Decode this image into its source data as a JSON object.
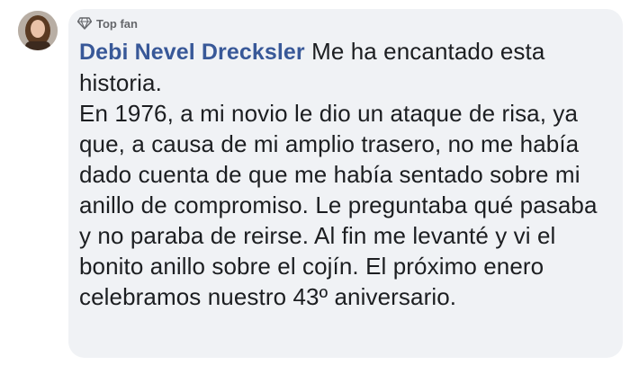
{
  "comment": {
    "badge": {
      "label": "Top fan",
      "icon": "diamond-icon"
    },
    "author": "Debi Nevel Drecksler",
    "text": " Me ha encantado esta historia.\nEn 1976, a mi novio le dio un ataque de risa, ya que, a causa de mi amplio trasero, no me había dado cuenta de que me había sentado sobre mi anillo de compromiso. Le preguntaba qué pasaba y no paraba de reirse. Al fin me levanté y vi el bonito anillo sobre el cojín. El próximo enero celebramos nuestro 43º aniversario."
  },
  "colors": {
    "author": "#385898",
    "bubble": "#f0f2f5",
    "text": "#1c1e21",
    "badge": "#65676b"
  }
}
